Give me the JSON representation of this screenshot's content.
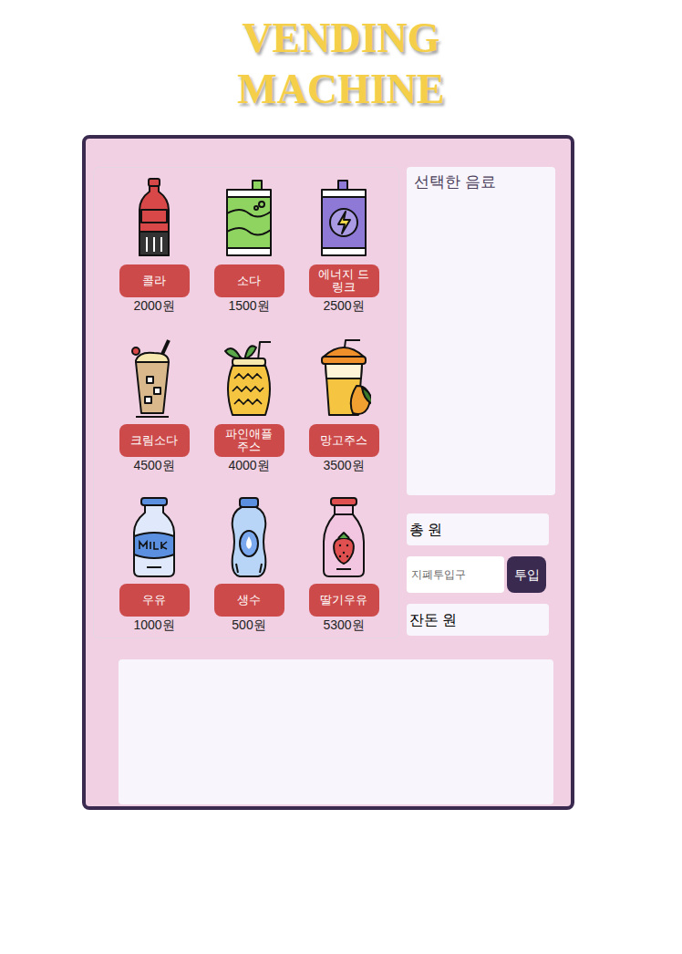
{
  "title": "VENDING MACHINE",
  "drinks": [
    {
      "name": "콜라",
      "price": "2000원"
    },
    {
      "name": "소다",
      "price": "1500원"
    },
    {
      "name": "에너지 드링크",
      "price": "2500원"
    },
    {
      "name": "크림소다",
      "price": "4500원"
    },
    {
      "name": "파인애플 주스",
      "price": "4000원"
    },
    {
      "name": "망고주스",
      "price": "3500원"
    },
    {
      "name": "우유",
      "price": "1000원"
    },
    {
      "name": "생수",
      "price": "500원"
    },
    {
      "name": "딸기우유",
      "price": "5300원"
    }
  ],
  "selected_panel": {
    "label": "선택한 음료"
  },
  "total": "총 원",
  "deposit": {
    "placeholder": "지폐투입구",
    "button": "투입"
  },
  "change": "잔돈 원"
}
